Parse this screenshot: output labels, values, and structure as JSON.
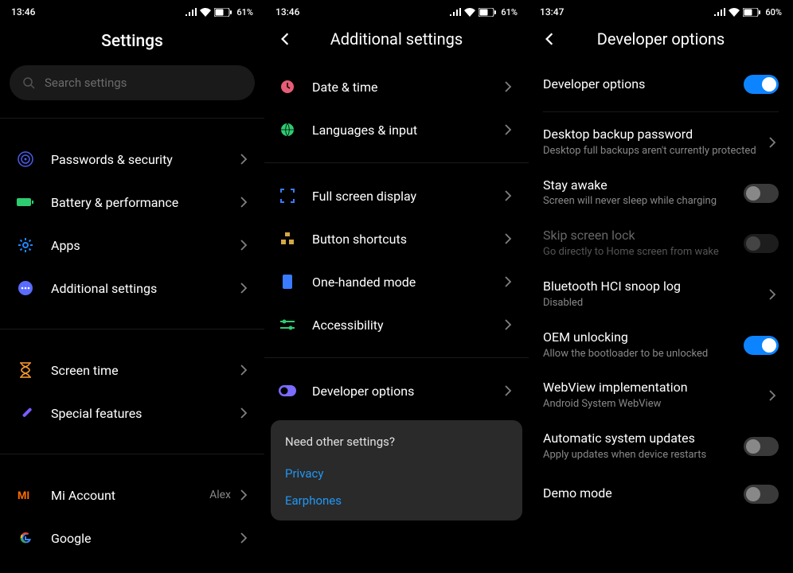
{
  "screens": {
    "settings": {
      "status": {
        "time": "13:46",
        "battery": "61%"
      },
      "title": "Settings",
      "search_placeholder": "Search settings",
      "groups": [
        [
          {
            "key": "passwords",
            "label": "Passwords & security"
          },
          {
            "key": "battery",
            "label": "Battery & performance"
          },
          {
            "key": "apps",
            "label": "Apps"
          },
          {
            "key": "additional",
            "label": "Additional settings"
          }
        ],
        [
          {
            "key": "screentime",
            "label": "Screen time"
          },
          {
            "key": "special",
            "label": "Special features"
          }
        ],
        [
          {
            "key": "miaccount",
            "label": "Mi Account",
            "value": "Alex"
          },
          {
            "key": "google",
            "label": "Google"
          }
        ]
      ]
    },
    "additional": {
      "status": {
        "time": "13:46",
        "battery": "61%"
      },
      "title": "Additional settings",
      "groups": [
        [
          {
            "key": "datetime",
            "label": "Date & time"
          },
          {
            "key": "languages",
            "label": "Languages & input"
          }
        ],
        [
          {
            "key": "fullscreen",
            "label": "Full screen display"
          },
          {
            "key": "shortcuts",
            "label": "Button shortcuts"
          },
          {
            "key": "onehanded",
            "label": "One-handed mode"
          },
          {
            "key": "accessibility",
            "label": "Accessibility"
          }
        ],
        [
          {
            "key": "devoptions",
            "label": "Developer options"
          }
        ]
      ],
      "card": {
        "title": "Need other settings?",
        "links": [
          "Privacy",
          "Earphones"
        ]
      }
    },
    "developer": {
      "status": {
        "time": "13:47",
        "battery": "60%"
      },
      "title": "Developer options",
      "master": {
        "label": "Developer options",
        "on": true
      },
      "items": [
        {
          "key": "backup",
          "title": "Desktop backup password",
          "sub": "Desktop full backups aren't currently protected",
          "type": "nav"
        },
        {
          "key": "stayawake",
          "title": "Stay awake",
          "sub": "Screen will never sleep while charging",
          "type": "toggle",
          "on": false
        },
        {
          "key": "skiplock",
          "title": "Skip screen lock",
          "sub": "Go directly to Home screen from wake",
          "type": "toggle",
          "on": false,
          "disabled": true
        },
        {
          "key": "hci",
          "title": "Bluetooth HCI snoop log",
          "sub": "Disabled",
          "type": "nav"
        },
        {
          "key": "oem",
          "title": "OEM unlocking",
          "sub": "Allow the bootloader to be unlocked",
          "type": "toggle",
          "on": true
        },
        {
          "key": "webview",
          "title": "WebView implementation",
          "sub": "Android System WebView",
          "type": "nav"
        },
        {
          "key": "autoupdates",
          "title": "Automatic system updates",
          "sub": "Apply updates when device restarts",
          "type": "toggle",
          "on": false
        },
        {
          "key": "demo",
          "title": "Demo mode",
          "sub": "",
          "type": "toggle",
          "on": false
        }
      ]
    }
  }
}
